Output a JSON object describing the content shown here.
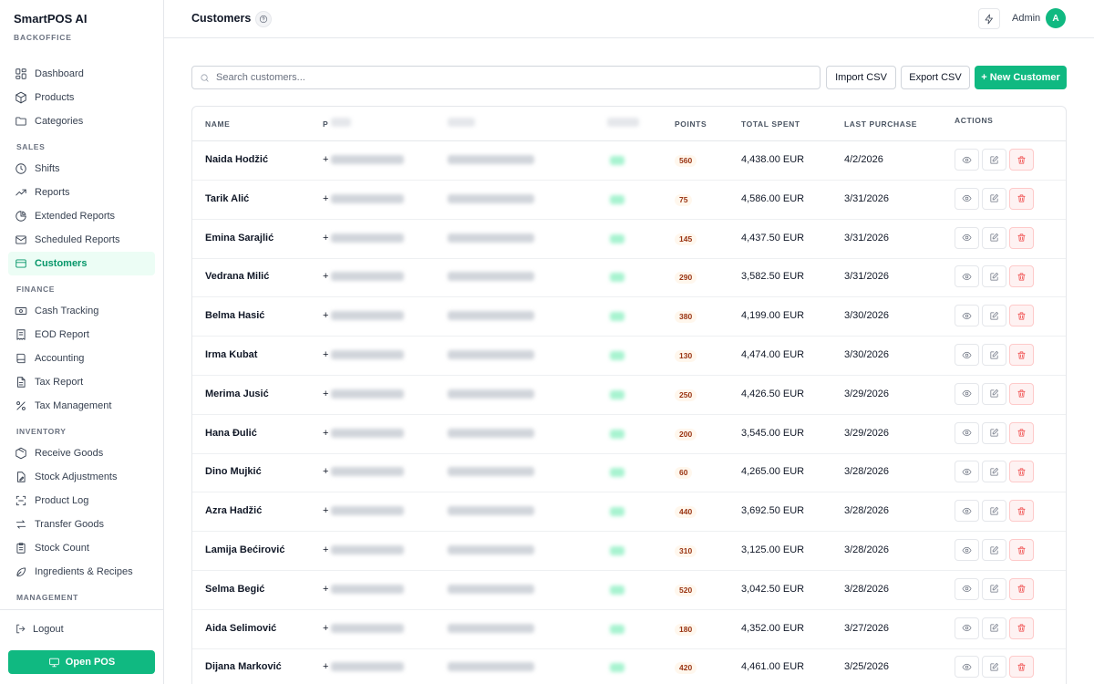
{
  "sidebar": {
    "brand": "SmartPOS AI",
    "brand_sub": "BACKOFFICE",
    "items": [
      {
        "type": "item",
        "label": "Dashboard",
        "icon": "dashboard-icon"
      },
      {
        "type": "item",
        "label": "Products",
        "icon": "cube-icon"
      },
      {
        "type": "item",
        "label": "Categories",
        "icon": "folder-icon"
      },
      {
        "type": "section",
        "label": "SALES"
      },
      {
        "type": "item",
        "label": "Shifts",
        "icon": "clock-icon"
      },
      {
        "type": "item",
        "label": "Reports",
        "icon": "trend-icon"
      },
      {
        "type": "item",
        "label": "Extended Reports",
        "icon": "pie-icon"
      },
      {
        "type": "item",
        "label": "Scheduled Reports",
        "icon": "mail-icon"
      },
      {
        "type": "item",
        "label": "Customers",
        "icon": "card-icon",
        "active": true
      },
      {
        "type": "section",
        "label": "FINANCE"
      },
      {
        "type": "item",
        "label": "Cash Tracking",
        "icon": "cash-icon"
      },
      {
        "type": "item",
        "label": "EOD Report",
        "icon": "receipt-icon"
      },
      {
        "type": "item",
        "label": "Accounting",
        "icon": "book-icon"
      },
      {
        "type": "item",
        "label": "Tax Report",
        "icon": "file-icon"
      },
      {
        "type": "item",
        "label": "Tax Management",
        "icon": "percent-icon"
      },
      {
        "type": "section",
        "label": "INVENTORY"
      },
      {
        "type": "item",
        "label": "Receive Goods",
        "icon": "package-icon"
      },
      {
        "type": "item",
        "label": "Stock Adjustments",
        "icon": "file-edit-icon"
      },
      {
        "type": "item",
        "label": "Product Log",
        "icon": "scan-icon"
      },
      {
        "type": "item",
        "label": "Transfer Goods",
        "icon": "arrows-icon"
      },
      {
        "type": "item",
        "label": "Stock Count",
        "icon": "clipboard-icon"
      },
      {
        "type": "item",
        "label": "Ingredients & Recipes",
        "icon": "leaf-icon"
      },
      {
        "type": "section",
        "label": "MANAGEMENT"
      }
    ],
    "logout": "Logout",
    "open_pos": "Open POS"
  },
  "header": {
    "title": "Customers",
    "user": "Admin",
    "avatar_initial": "A"
  },
  "toolbar": {
    "search_placeholder": "Search customers...",
    "import": "Import CSV",
    "export": "Export CSV",
    "new": "+ New Customer"
  },
  "table": {
    "columns": {
      "name": "NAME",
      "phone_partial": "P",
      "points": "POINTS",
      "total_spent": "TOTAL SPENT",
      "last_purchase": "LAST PURCHASE",
      "actions": "ACTIONS"
    },
    "rows": [
      {
        "name": "Naida Hodžić",
        "phone_prefix": "+",
        "points": "560",
        "spent": "4,438.00 EUR",
        "date": "4/2/2026"
      },
      {
        "name": "Tarik Alić",
        "phone_prefix": "+",
        "points": "75",
        "spent": "4,586.00 EUR",
        "date": "3/31/2026"
      },
      {
        "name": "Emina Sarajlić",
        "phone_prefix": "+",
        "points": "145",
        "spent": "4,437.50 EUR",
        "date": "3/31/2026"
      },
      {
        "name": "Vedrana Milić",
        "phone_prefix": "+",
        "points": "290",
        "spent": "3,582.50 EUR",
        "date": "3/31/2026"
      },
      {
        "name": "Belma Hasić",
        "phone_prefix": "+",
        "points": "380",
        "spent": "4,199.00 EUR",
        "date": "3/30/2026"
      },
      {
        "name": "Irma Kubat",
        "phone_prefix": "+",
        "points": "130",
        "spent": "4,474.00 EUR",
        "date": "3/30/2026"
      },
      {
        "name": "Merima Jusić",
        "phone_prefix": "+",
        "points": "250",
        "spent": "4,426.50 EUR",
        "date": "3/29/2026"
      },
      {
        "name": "Hana Đulić",
        "phone_prefix": "+",
        "points": "200",
        "spent": "3,545.00 EUR",
        "date": "3/29/2026"
      },
      {
        "name": "Dino Mujkić",
        "phone_prefix": "+",
        "points": "60",
        "spent": "4,265.00 EUR",
        "date": "3/28/2026"
      },
      {
        "name": "Azra Hadžić",
        "phone_prefix": "+",
        "points": "440",
        "spent": "3,692.50 EUR",
        "date": "3/28/2026"
      },
      {
        "name": "Lamija Bećirović",
        "phone_prefix": "+",
        "points": "310",
        "spent": "3,125.00 EUR",
        "date": "3/28/2026"
      },
      {
        "name": "Selma Begić",
        "phone_prefix": "+",
        "points": "520",
        "spent": "3,042.50 EUR",
        "date": "3/28/2026"
      },
      {
        "name": "Aida Selimović",
        "phone_prefix": "+",
        "points": "180",
        "spent": "4,352.00 EUR",
        "date": "3/27/2026"
      },
      {
        "name": "Dijana Marković",
        "phone_prefix": "+",
        "points": "420",
        "spent": "4,461.00 EUR",
        "date": "3/25/2026"
      }
    ]
  },
  "colors": {
    "accent": "#10b981",
    "accent_bg": "#ecfdf5",
    "danger": "#ef4444"
  }
}
